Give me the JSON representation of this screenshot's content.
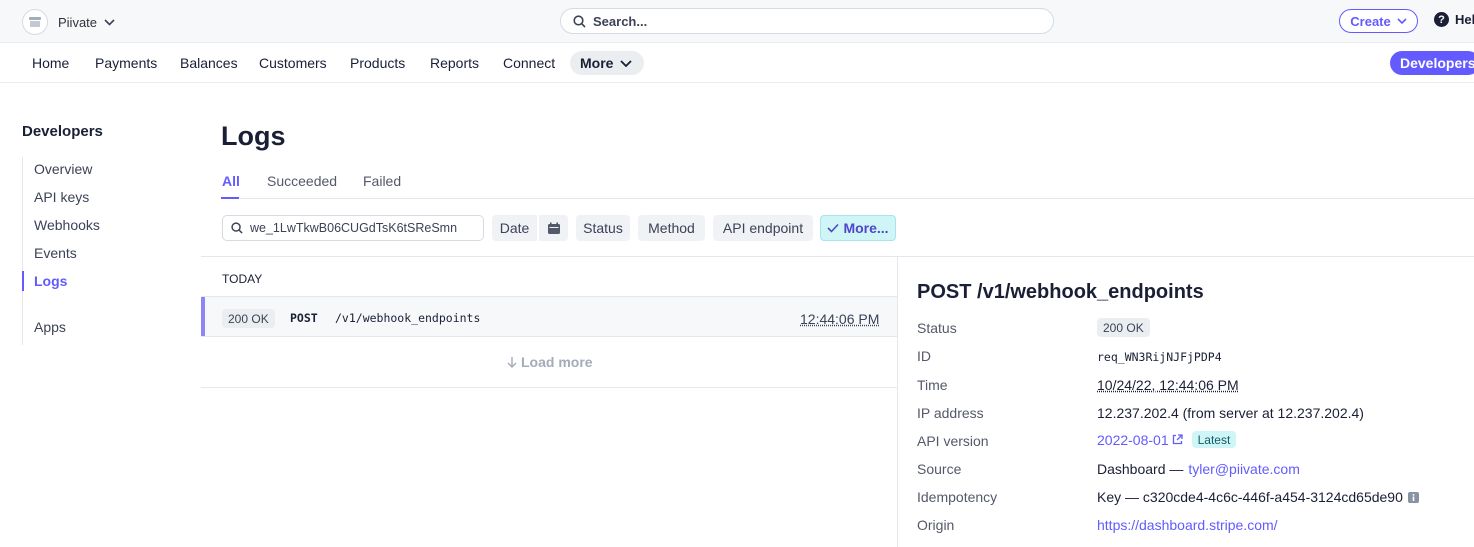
{
  "topbar": {
    "account_name": "Piivate",
    "search_placeholder": "Search...",
    "create_label": "Create",
    "help_label": "Help"
  },
  "nav": {
    "items": [
      "Home",
      "Payments",
      "Balances",
      "Customers",
      "Products",
      "Reports",
      "Connect"
    ],
    "more_label": "More",
    "developers_label": "Developers"
  },
  "sidebar": {
    "title": "Developers",
    "items": [
      "Overview",
      "API keys",
      "Webhooks",
      "Events",
      "Logs",
      "Apps"
    ],
    "active": "Logs"
  },
  "main": {
    "title": "Logs",
    "tabs": [
      "All",
      "Succeeded",
      "Failed"
    ],
    "active_tab": "All",
    "filter_value": "we_1LwTkwB06CUGdTsK6tSReSmn",
    "filters": [
      "Date",
      "Status",
      "Method",
      "API endpoint",
      "More..."
    ],
    "group_label": "TODAY",
    "rows": [
      {
        "status": "200 OK",
        "method": "POST",
        "path": "/v1/webhook_endpoints",
        "time": "12:44:06 PM"
      }
    ],
    "load_more_label": "Load more"
  },
  "detail": {
    "title": "POST /v1/webhook_endpoints",
    "fields": [
      {
        "label": "Status",
        "value": "200 OK"
      },
      {
        "label": "ID",
        "value": "req_WN3RijNJFjPDP4"
      },
      {
        "label": "Time",
        "value": "10/24/22, 12:44:06 PM"
      },
      {
        "label": "IP address",
        "value": "12.237.202.4 (from server at 12.237.202.4)"
      },
      {
        "label": "API version",
        "value": "2022-08-01",
        "badge": "Latest"
      },
      {
        "label": "Source",
        "value": "Dashboard —",
        "link": "tyler@piivate.com"
      },
      {
        "label": "Idempotency",
        "value": "Key — c320cde4-4c6c-446f-a454-3124cd65de90"
      },
      {
        "label": "Origin",
        "value": "https://dashboard.stripe.com/"
      }
    ]
  },
  "colors": {
    "accent": "#635bff",
    "cyan_chip": "#cff5f6",
    "topbar_bg": "#f6f8fa"
  }
}
